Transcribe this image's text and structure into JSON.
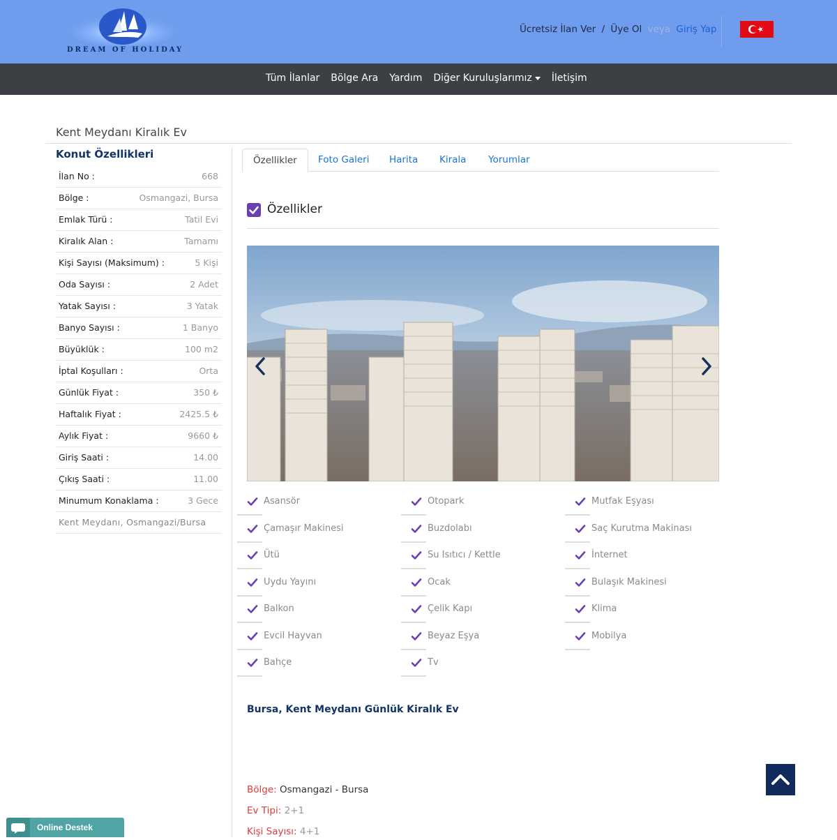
{
  "header": {
    "logo_text": "DREAM OF HOLIDAY",
    "links": {
      "post_ad": "Ücretsiz İlan Ver",
      "sep1": "/",
      "signup": "Üye Ol",
      "faded": "veya",
      "login": "Giriş Yap"
    },
    "language_flag": "turkey-flag-icon"
  },
  "nav": {
    "items": [
      "Tüm İlanlar",
      "Bölge Ara",
      "Yardım",
      "Diğer Kuruluşlarımız",
      "İletişim"
    ]
  },
  "page": {
    "title": "Kent Meydanı Kiralık Ev"
  },
  "sidebar": {
    "title": "Konut Özellikleri",
    "specs": [
      {
        "key": "İlan No :",
        "value": "668"
      },
      {
        "key": "Bölge :",
        "value": "Osmangazi, Bursa"
      },
      {
        "key": "Emlak Türü :",
        "value": "Tatil Evi"
      },
      {
        "key": "Kiralık Alan :",
        "value": "Tamamı"
      },
      {
        "key": "Kişi Sayısı (Maksimum) :",
        "value": "5 Kişi"
      },
      {
        "key": "Oda Sayısı :",
        "value": "2 Adet"
      },
      {
        "key": "Yatak Sayısı :",
        "value": "3 Yatak"
      },
      {
        "key": "Banyo Sayısı :",
        "value": "1 Banyo"
      },
      {
        "key": "Büyüklük :",
        "value": "100 m2"
      },
      {
        "key": "İptal Koşulları :",
        "value": "Orta"
      },
      {
        "key": "Günlük Fiyat :",
        "value": "350 ₺"
      },
      {
        "key": "Haftalık Fiyat :",
        "value": "2425.5 ₺"
      },
      {
        "key": "Aylık Fiyat :",
        "value": "9660 ₺"
      },
      {
        "key": "Giriş Saati :",
        "value": "14.00"
      },
      {
        "key": "Çıkış Saati :",
        "value": "11.00"
      },
      {
        "key": "Minumum Konaklama :",
        "value": "3 Gece"
      }
    ],
    "address": "Kent Meydanı, Osmangazi/Bursa"
  },
  "tabs": [
    "Özellikler",
    "Foto Galeri",
    "Harita",
    "Kirala",
    "Yorumlar"
  ],
  "features_section": {
    "title": "Özellikler",
    "items": [
      "Asansör",
      "Otopark",
      "Mutfak Eşyası",
      "Çamaşır Makinesi",
      "Buzdolabı",
      "Saç Kurutma Makinası",
      "Ütü",
      "Su Isıtıcı / Kettle",
      "İnternet",
      "Uydu Yayını",
      "Ocak",
      "Bulaşık Makinesi",
      "Balkon",
      "Çelik Kapı",
      "Klima",
      "Evcil Hayvan",
      "Beyaz Eşya",
      "Mobilya",
      "Bahçe",
      "Tv"
    ]
  },
  "description": {
    "title": "Bursa, Kent Meydanı Günlük Kiralık Ev",
    "rows": [
      {
        "key": "Bölge:",
        "value": "Osmangazi - Bursa"
      },
      {
        "key": "Ev Tipi:",
        "value": "2+1"
      },
      {
        "key": "Kişi Sayısı:",
        "value": "4+1"
      }
    ]
  },
  "widgets": {
    "support_label": "Online Destek",
    "back_to_top_icon": "chevron-up-icon"
  },
  "colors": {
    "header_bg": "#6f9cec",
    "navbar_bg": "#3c3f44",
    "accent_purple": "#6a3fb0",
    "link_blue": "#1a73d9",
    "label_red": "#e03a3a",
    "navy": "#123466"
  }
}
